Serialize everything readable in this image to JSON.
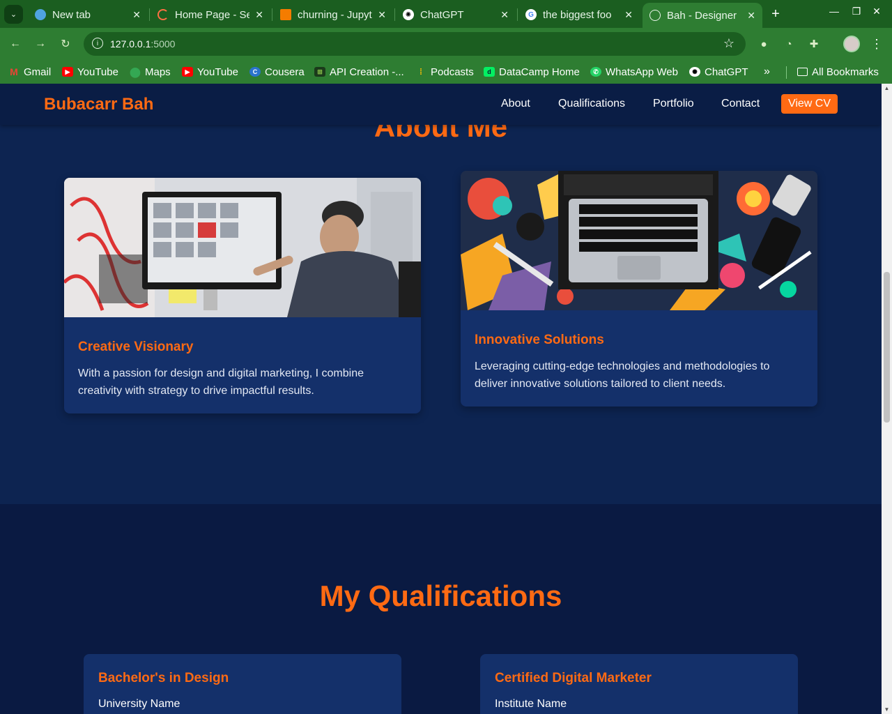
{
  "browser": {
    "tabs": [
      {
        "title": "New tab",
        "favicon": "new-tab-icon"
      },
      {
        "title": "Home Page - Se",
        "favicon": "loading-icon"
      },
      {
        "title": "churning - Jupyt",
        "favicon": "notebook-icon"
      },
      {
        "title": "ChatGPT",
        "favicon": "chatgpt-icon"
      },
      {
        "title": "the biggest foo",
        "favicon": "google-icon"
      },
      {
        "title": "Bah - Designer",
        "favicon": "globe-icon"
      }
    ],
    "url_host": "127.0.0.1",
    "url_port": ":5000",
    "bookmarks": [
      {
        "label": "Gmail",
        "icon": "gmail-icon",
        "color": "#ea4335"
      },
      {
        "label": "YouTube",
        "icon": "youtube-icon",
        "color": "#ff0000"
      },
      {
        "label": "Maps",
        "icon": "maps-icon",
        "color": "#34a853"
      },
      {
        "label": "YouTube",
        "icon": "youtube-icon",
        "color": "#ff0000"
      },
      {
        "label": "Cousera",
        "icon": "coursera-icon",
        "color": "#2a73cc"
      },
      {
        "label": "API Creation -...",
        "icon": "api-icon",
        "color": "#1b3a1b"
      },
      {
        "label": "Podcasts",
        "icon": "podcasts-icon",
        "color": "#fbbc04"
      },
      {
        "label": "DataCamp Home",
        "icon": "datacamp-icon",
        "color": "#03ef62"
      },
      {
        "label": "WhatsApp Web",
        "icon": "whatsapp-icon",
        "color": "#25d366"
      },
      {
        "label": "ChatGPT",
        "icon": "chatgpt-icon",
        "color": "#ffffff"
      }
    ],
    "all_bookmarks": "All Bookmarks"
  },
  "site": {
    "brand": "Bubacarr Bah",
    "nav": [
      "About",
      "Qualifications",
      "Portfolio",
      "Contact"
    ],
    "cta": "View CV",
    "accent": "#ff6a13"
  },
  "about": {
    "title": "About Me",
    "cards": [
      {
        "title": "Creative Visionary",
        "text": "With a passion for design and digital marketing, I combine creativity with strategy to drive impactful results."
      },
      {
        "title": "Innovative Solutions",
        "text": "Leveraging cutting-edge technologies and methodologies to deliver innovative solutions tailored to client needs."
      }
    ]
  },
  "qualifications": {
    "title": "My Qualifications",
    "items": [
      {
        "title": "Bachelor's in Design",
        "org": "University Name"
      },
      {
        "title": "Certified Digital Marketer",
        "org": "Institute Name"
      }
    ]
  }
}
